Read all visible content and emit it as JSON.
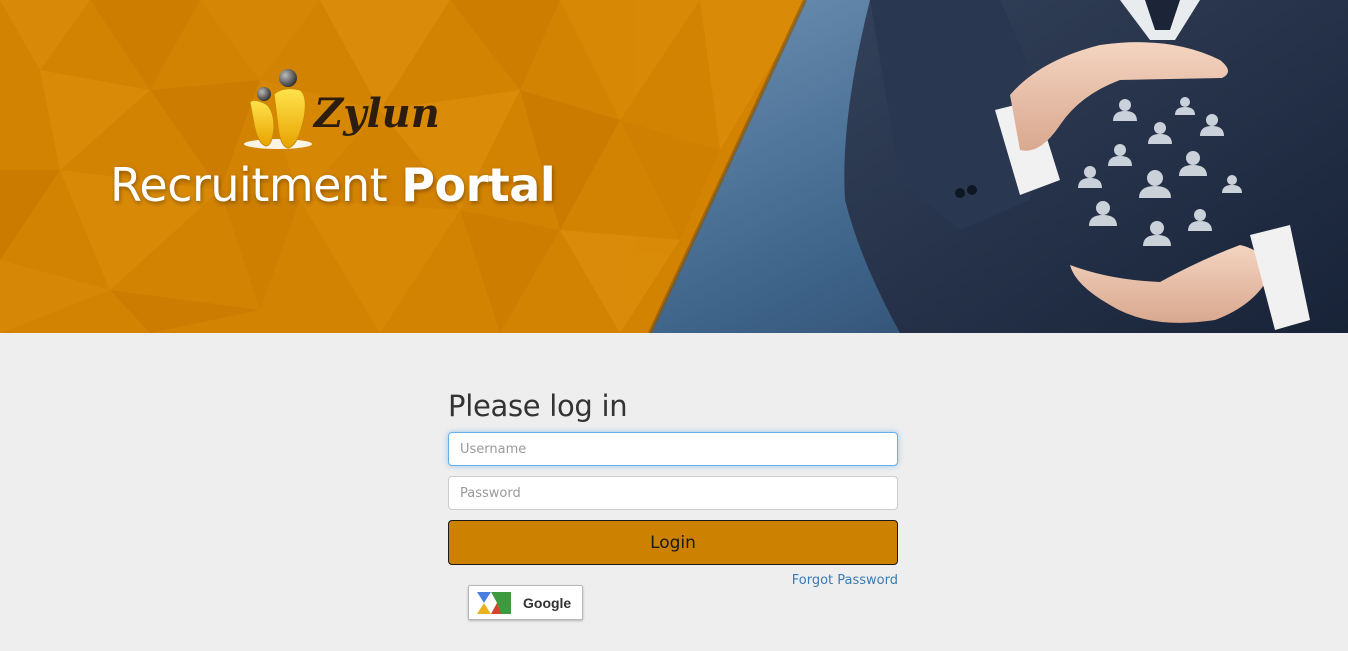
{
  "brand": {
    "logo_text": "Zylun",
    "title_regular": "Recruitment",
    "title_bold": "Portal",
    "accent_color": "#d07f00"
  },
  "login": {
    "heading": "Please log in",
    "username_placeholder": "Username",
    "password_placeholder": "Password",
    "login_label": "Login",
    "forgot_label": "Forgot Password",
    "google_label": "Google",
    "button_color": "#cc8100",
    "link_color": "#3a7ab6"
  },
  "icons": {
    "logo": "zylun-people-logo-icon",
    "google": "google-apps-icon",
    "people_network": "people-network-icon"
  }
}
